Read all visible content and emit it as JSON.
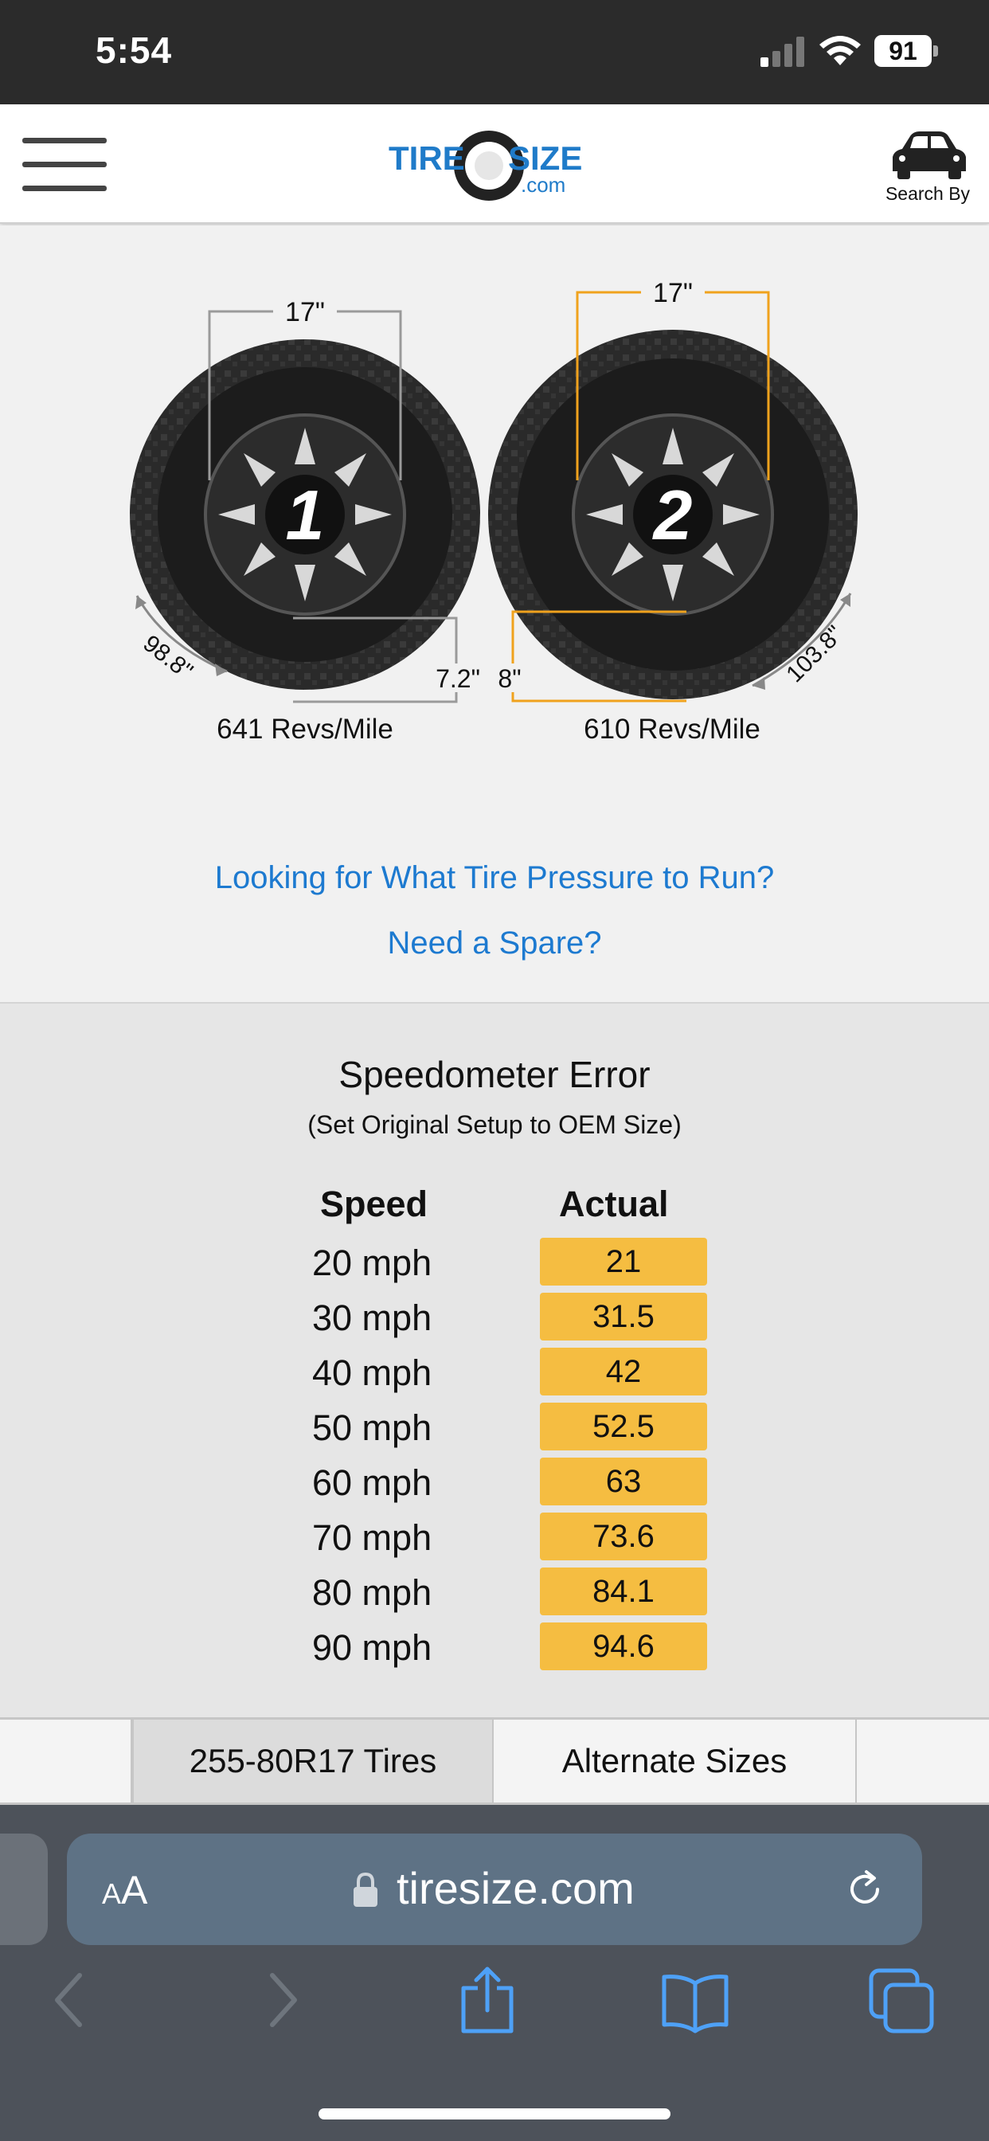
{
  "status_bar": {
    "time": "5:54",
    "battery": "91"
  },
  "header": {
    "logo_text_tire": "TIRE",
    "logo_text_size": "SIZE",
    "logo_text_com": ".com",
    "search_by_label": "Search By"
  },
  "tires": {
    "tire1": {
      "number": "1",
      "rim": "17\"",
      "sidewall": "7.2\"",
      "circumference": "98.8\"",
      "revs": "641 Revs/Mile"
    },
    "tire2": {
      "number": "2",
      "rim": "17\"",
      "sidewall": "8\"",
      "circumference": "103.8\"",
      "revs": "610 Revs/Mile"
    }
  },
  "links": {
    "pressure": "Looking for What Tire Pressure to Run?",
    "spare": "Need a Spare?"
  },
  "speedometer": {
    "title": "Speedometer Error",
    "subtitle": "(Set Original Setup to OEM Size)",
    "col_speed": "Speed",
    "col_actual": "Actual",
    "rows": [
      {
        "speed": "20 mph",
        "actual": "21"
      },
      {
        "speed": "30 mph",
        "actual": "31.5"
      },
      {
        "speed": "40 mph",
        "actual": "42"
      },
      {
        "speed": "50 mph",
        "actual": "52.5"
      },
      {
        "speed": "60 mph",
        "actual": "63"
      },
      {
        "speed": "70 mph",
        "actual": "73.6"
      },
      {
        "speed": "80 mph",
        "actual": "84.1"
      },
      {
        "speed": "90 mph",
        "actual": "94.6"
      }
    ]
  },
  "tabs": {
    "tires": "255-80R17 Tires",
    "alternate": "Alternate Sizes"
  },
  "browser": {
    "aa_big": "A",
    "aa_small": "A",
    "url": "tiresize.com"
  },
  "colors": {
    "accent_link": "#1d7ad0",
    "actual_fill": "#f5bd41",
    "tire2_line": "#f0a21d"
  },
  "icons": {
    "status": [
      "signal-icon",
      "wifi-icon",
      "battery-icon"
    ],
    "header": [
      "menu-icon",
      "car-icon"
    ],
    "browser": [
      "lock-icon",
      "reload-icon",
      "back-icon",
      "forward-icon",
      "share-icon",
      "bookmarks-icon",
      "tabs-icon"
    ]
  }
}
